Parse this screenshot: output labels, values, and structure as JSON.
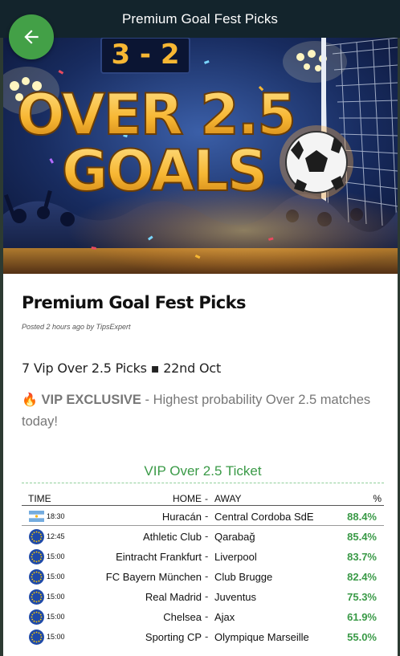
{
  "topbar": {
    "title": "Premium Goal Fest Picks"
  },
  "back_button": {
    "icon": "arrow-left-icon",
    "color": "#43a047"
  },
  "hero": {
    "scoreboard": "3 - 2",
    "headline_line1": "OVER 2.5",
    "headline_line2": "GOALS"
  },
  "post": {
    "title": "Premium Goal Fest Picks",
    "meta": "Posted 2 hours ago by TipsExpert",
    "subheading": "7 Vip Over 2.5 Picks ▪ 22nd Oct",
    "vip_emoji": "🔥",
    "vip_label": "VIP EXCLUSIVE",
    "vip_text": " - Highest probability Over 2.5 matches today!"
  },
  "ticket": {
    "title": "VIP Over 2.5 Ticket",
    "headers": {
      "time": "TIME",
      "home": "HOME",
      "sep": "-",
      "away": "AWAY",
      "pct": "%"
    },
    "rows": [
      {
        "flag": "argentina-flag-icon",
        "time": "18:30",
        "home": "Huracán",
        "away": "Central Cordoba SdE",
        "pct": "88.4%"
      },
      {
        "flag": "eu-flag-icon",
        "time": "12:45",
        "home": "Athletic Club",
        "away": "Qarabağ",
        "pct": "85.4%"
      },
      {
        "flag": "eu-flag-icon",
        "time": "15:00",
        "home": "Eintracht Frankfurt",
        "away": "Liverpool",
        "pct": "83.7%"
      },
      {
        "flag": "eu-flag-icon",
        "time": "15:00",
        "home": "FC Bayern München",
        "away": "Club Brugge",
        "pct": "82.4%"
      },
      {
        "flag": "eu-flag-icon",
        "time": "15:00",
        "home": "Real Madrid",
        "away": "Juventus",
        "pct": "75.3%"
      },
      {
        "flag": "eu-flag-icon",
        "time": "15:00",
        "home": "Chelsea",
        "away": "Ajax",
        "pct": "61.9%"
      },
      {
        "flag": "eu-flag-icon",
        "time": "15:00",
        "home": "Sporting CP",
        "away": "Olympique Marseille",
        "pct": "55.0%"
      }
    ]
  },
  "colors": {
    "topbar": "#13242c",
    "accent_green": "#3a9a47",
    "headline_gold": "#f7b733"
  }
}
